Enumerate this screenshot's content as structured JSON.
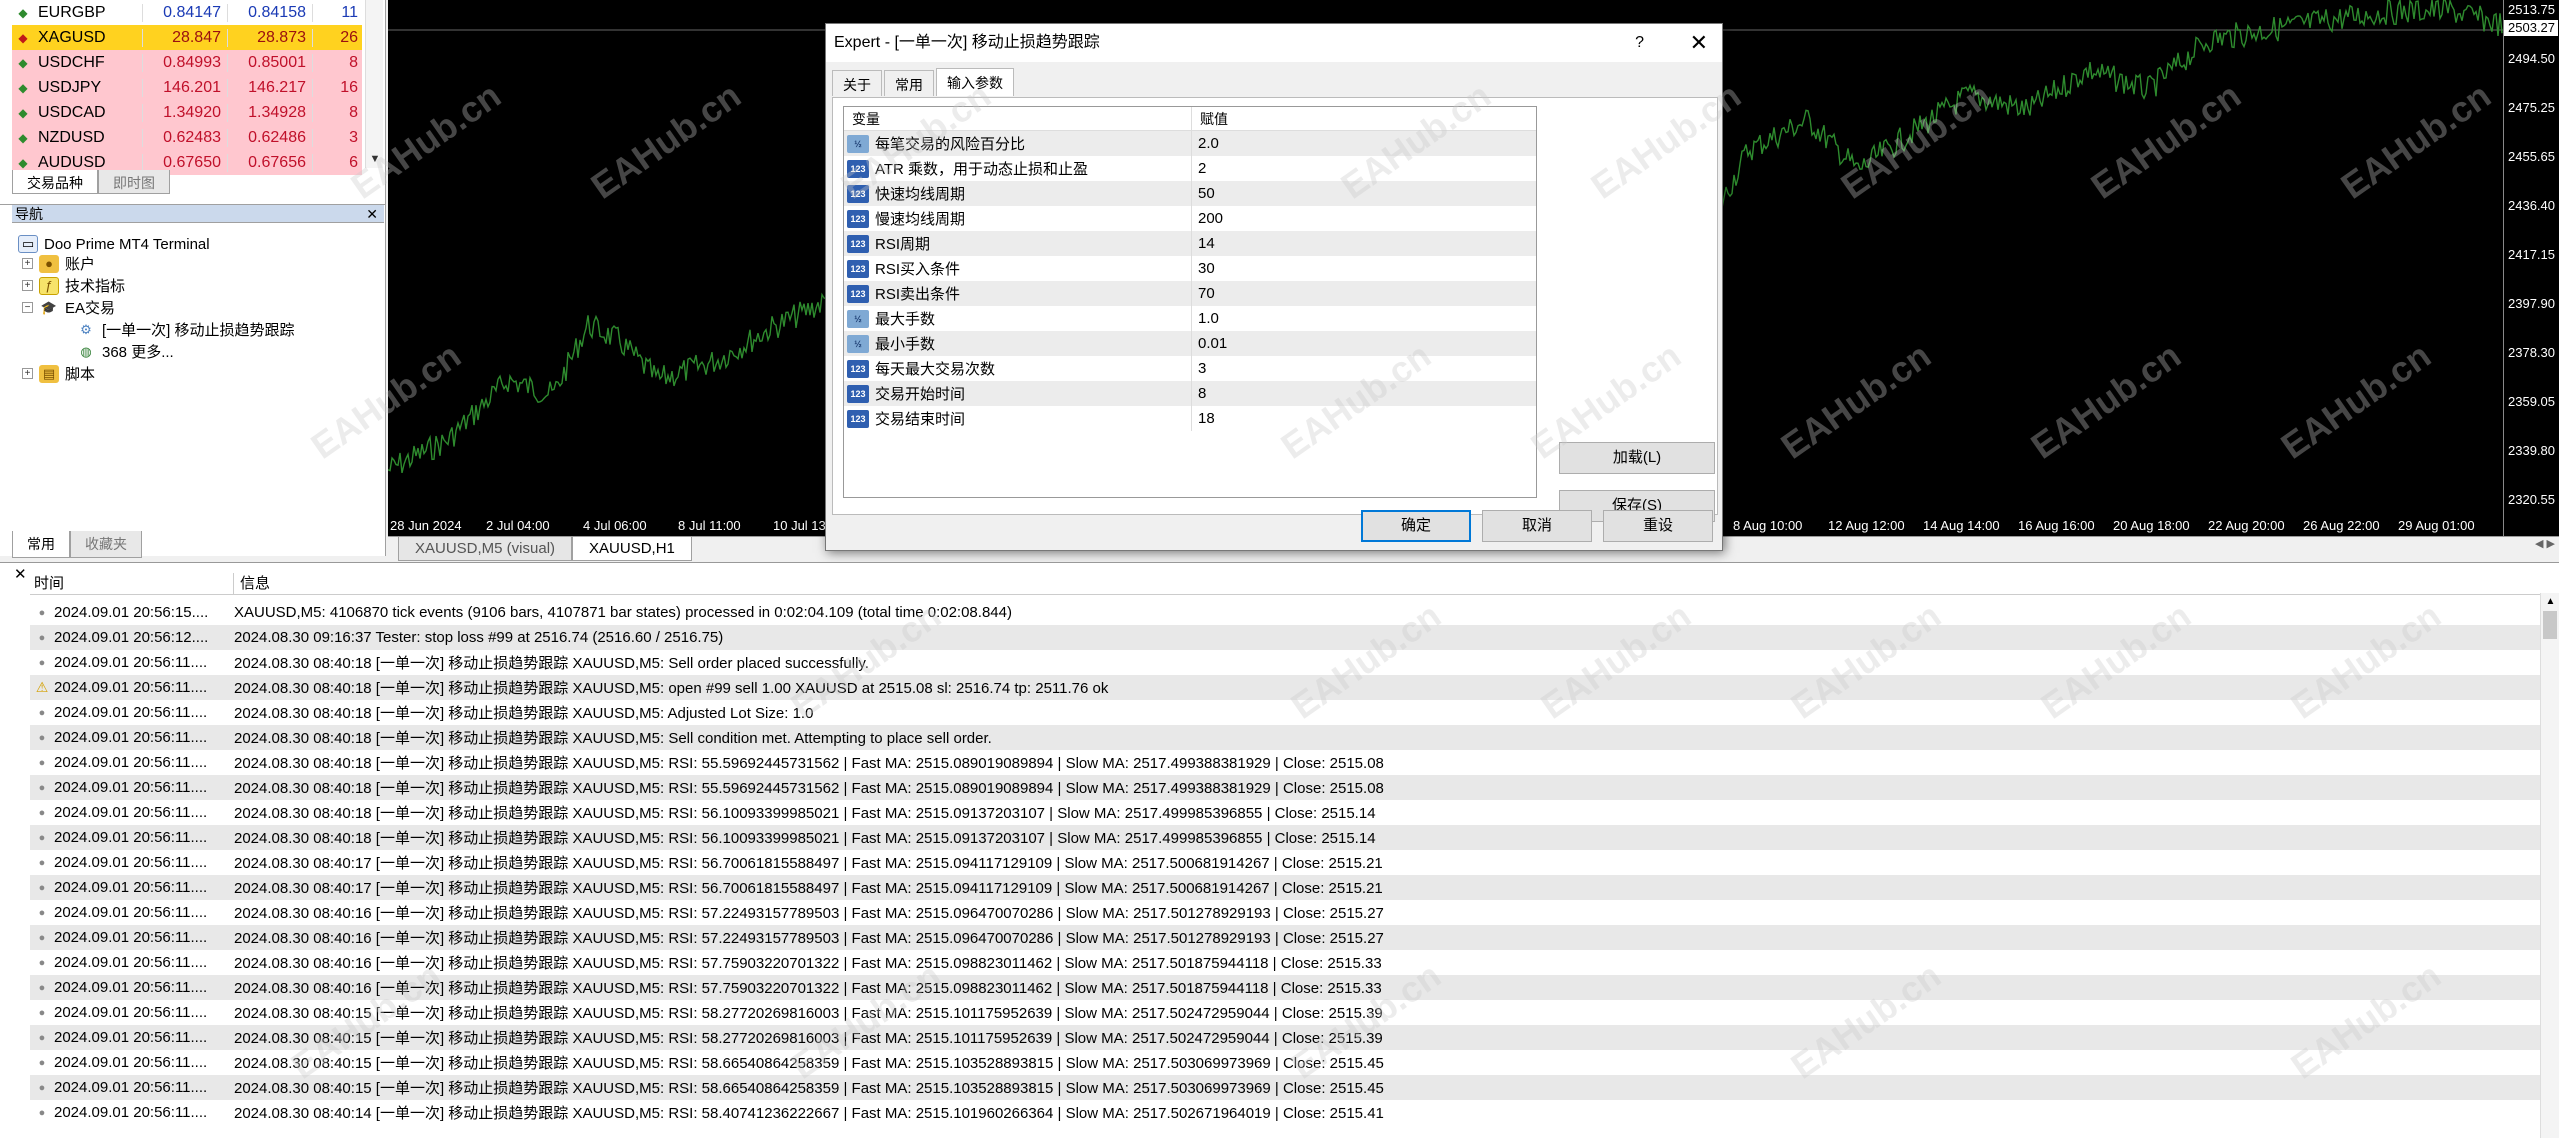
{
  "market_watch": {
    "rows": [
      {
        "symbol": "EURGBP",
        "bid": "0.84147",
        "ask": "0.84158",
        "spread": "11",
        "style": "white",
        "arrow": "◆"
      },
      {
        "symbol": "XAGUSD",
        "bid": "28.847",
        "ask": "28.873",
        "spread": "26",
        "style": "yellow",
        "arrow": "◆"
      },
      {
        "symbol": "USDCHF",
        "bid": "0.84993",
        "ask": "0.85001",
        "spread": "8",
        "style": "pink",
        "arrow": "◆"
      },
      {
        "symbol": "USDJPY",
        "bid": "146.201",
        "ask": "146.217",
        "spread": "16",
        "style": "pink",
        "arrow": "◆"
      },
      {
        "symbol": "USDCAD",
        "bid": "1.34920",
        "ask": "1.34928",
        "spread": "8",
        "style": "pink",
        "arrow": "◆"
      },
      {
        "symbol": "NZDUSD",
        "bid": "0.62483",
        "ask": "0.62486",
        "spread": "3",
        "style": "pink",
        "arrow": "◆"
      },
      {
        "symbol": "AUDUSD",
        "bid": "0.67650",
        "ask": "0.67656",
        "spread": "6",
        "style": "pink",
        "arrow": "◆"
      }
    ],
    "tabs": [
      "交易品种",
      "即时图"
    ]
  },
  "navigator": {
    "title": "导航",
    "root": "Doo Prime MT4 Terminal",
    "accounts": "账户",
    "indicators": "技术指标",
    "ea": "EA交易",
    "ea_item": "[一单一次] 移动止损趋势跟踪",
    "more": "368 更多...",
    "scripts": "脚本",
    "tabs": [
      "常用",
      "收藏夹"
    ]
  },
  "chart": {
    "line_color": "#2e8b2e",
    "prices": [
      "2513.75",
      "2494.50",
      "2475.25",
      "2455.65",
      "2436.40",
      "2417.15",
      "2397.90",
      "2378.30",
      "2359.05",
      "2339.80",
      "2320.55"
    ],
    "current_price": "2503.27",
    "times_left": [
      "28 Jun 2024",
      "2 Jul 04:00",
      "4 Jul 06:00",
      "8 Jul 11:00",
      "10 Jul 13"
    ],
    "times_right": [
      "8 Aug 10:00",
      "12 Aug 12:00",
      "14 Aug 14:00",
      "16 Aug 16:00",
      "20 Aug 18:00",
      "22 Aug 20:00",
      "26 Aug 22:00",
      "29 Aug 01:00"
    ],
    "tabs": [
      "XAUUSD,M5 (visual)",
      "XAUUSD,H1"
    ]
  },
  "dialog": {
    "title": "Expert - [一单一次] 移动止损趋势跟踪",
    "help": "?",
    "close": "✕",
    "tabs": [
      "关于",
      "常用",
      "输入参数"
    ],
    "col_var": "变量",
    "col_val": "赋值",
    "params": [
      {
        "name": "每笔交易的风险百分比",
        "value": "2.0",
        "type": "dbl"
      },
      {
        "name": "ATR 乘数，用于动态止损和止盈",
        "value": "2",
        "type": "int"
      },
      {
        "name": "快速均线周期",
        "value": "50",
        "type": "int"
      },
      {
        "name": "慢速均线周期",
        "value": "200",
        "type": "int"
      },
      {
        "name": "RSI周期",
        "value": "14",
        "type": "int"
      },
      {
        "name": "RSI买入条件",
        "value": "30",
        "type": "int"
      },
      {
        "name": "RSI卖出条件",
        "value": "70",
        "type": "int"
      },
      {
        "name": "最大手数",
        "value": "1.0",
        "type": "dbl"
      },
      {
        "name": "最小手数",
        "value": "0.01",
        "type": "dbl"
      },
      {
        "name": "每天最大交易次数",
        "value": "3",
        "type": "int"
      },
      {
        "name": "交易开始时间",
        "value": "8",
        "type": "int"
      },
      {
        "name": "交易结束时间",
        "value": "18",
        "type": "int"
      }
    ],
    "btn_load": "加载(L)",
    "btn_save": "保存(S)",
    "btn_ok": "确定",
    "btn_cancel": "取消",
    "btn_reset": "重设"
  },
  "journal": {
    "col_time": "时间",
    "col_msg": "信息",
    "rows": [
      {
        "time": "2024.09.01 20:56:15....",
        "msg": "XAUUSD,M5: 4106870 tick events (9106 bars, 4107871 bar states) processed in 0:02:04.109 (total time 0:02:08.844)",
        "warn": false
      },
      {
        "time": "2024.09.01 20:56:12....",
        "msg": "2024.08.30 09:16:37  Tester: stop loss #99 at 2516.74 (2516.60 / 2516.75)",
        "warn": false
      },
      {
        "time": "2024.09.01 20:56:11....",
        "msg": "2024.08.30 08:40:18   [一单一次] 移动止损趋势跟踪 XAUUSD,M5: Sell order placed successfully.",
        "warn": false
      },
      {
        "time": "2024.09.01 20:56:11....",
        "msg": "2024.08.30 08:40:18   [一单一次] 移动止损趋势跟踪 XAUUSD,M5: open #99 sell 1.00 XAUUSD at 2515.08 sl: 2516.74 tp: 2511.76 ok",
        "warn": true
      },
      {
        "time": "2024.09.01 20:56:11....",
        "msg": "2024.08.30 08:40:18   [一单一次] 移动止损趋势跟踪 XAUUSD,M5: Adjusted Lot Size: 1.0",
        "warn": false
      },
      {
        "time": "2024.09.01 20:56:11....",
        "msg": "2024.08.30 08:40:18   [一单一次] 移动止损趋势跟踪 XAUUSD,M5: Sell condition met. Attempting to place sell order.",
        "warn": false
      },
      {
        "time": "2024.09.01 20:56:11....",
        "msg": "2024.08.30 08:40:18   [一单一次] 移动止损趋势跟踪 XAUUSD,M5: RSI: 55.59692445731562 | Fast MA: 2515.089019089894 | Slow MA: 2517.499388381929 | Close: 2515.08",
        "warn": false
      },
      {
        "time": "2024.09.01 20:56:11....",
        "msg": "2024.08.30 08:40:18   [一单一次] 移动止损趋势跟踪 XAUUSD,M5: RSI: 55.59692445731562 | Fast MA: 2515.089019089894 | Slow MA: 2517.499388381929 | Close: 2515.08",
        "warn": false
      },
      {
        "time": "2024.09.01 20:56:11....",
        "msg": "2024.08.30 08:40:18   [一单一次] 移动止损趋势跟踪 XAUUSD,M5: RSI: 56.10093399985021 | Fast MA: 2515.09137203107 | Slow MA: 2517.499985396855 | Close: 2515.14",
        "warn": false
      },
      {
        "time": "2024.09.01 20:56:11....",
        "msg": "2024.08.30 08:40:18   [一单一次] 移动止损趋势跟踪 XAUUSD,M5: RSI: 56.10093399985021 | Fast MA: 2515.09137203107 | Slow MA: 2517.499985396855 | Close: 2515.14",
        "warn": false
      },
      {
        "time": "2024.09.01 20:56:11....",
        "msg": "2024.08.30 08:40:17   [一单一次] 移动止损趋势跟踪 XAUUSD,M5: RSI: 56.70061815588497 | Fast MA: 2515.094117129109 | Slow MA: 2517.500681914267 | Close: 2515.21",
        "warn": false
      },
      {
        "time": "2024.09.01 20:56:11....",
        "msg": "2024.08.30 08:40:17   [一单一次] 移动止损趋势跟踪 XAUUSD,M5: RSI: 56.70061815588497 | Fast MA: 2515.094117129109 | Slow MA: 2517.500681914267 | Close: 2515.21",
        "warn": false
      },
      {
        "time": "2024.09.01 20:56:11....",
        "msg": "2024.08.30 08:40:16   [一单一次] 移动止损趋势跟踪 XAUUSD,M5: RSI: 57.22493157789503 | Fast MA: 2515.096470070286 | Slow MA: 2517.501278929193 | Close: 2515.27",
        "warn": false
      },
      {
        "time": "2024.09.01 20:56:11....",
        "msg": "2024.08.30 08:40:16   [一单一次] 移动止损趋势跟踪 XAUUSD,M5: RSI: 57.22493157789503 | Fast MA: 2515.096470070286 | Slow MA: 2517.501278929193 | Close: 2515.27",
        "warn": false
      },
      {
        "time": "2024.09.01 20:56:11....",
        "msg": "2024.08.30 08:40:16   [一单一次] 移动止损趋势跟踪 XAUUSD,M5: RSI: 57.75903220701322 | Fast MA: 2515.098823011462 | Slow MA: 2517.501875944118 | Close: 2515.33",
        "warn": false
      },
      {
        "time": "2024.09.01 20:56:11....",
        "msg": "2024.08.30 08:40:16   [一单一次] 移动止损趋势跟踪 XAUUSD,M5: RSI: 57.75903220701322 | Fast MA: 2515.098823011462 | Slow MA: 2517.501875944118 | Close: 2515.33",
        "warn": false
      },
      {
        "time": "2024.09.01 20:56:11....",
        "msg": "2024.08.30 08:40:15   [一单一次] 移动止损趋势跟踪 XAUUSD,M5: RSI: 58.27720269816003 | Fast MA: 2515.101175952639 | Slow MA: 2517.502472959044 | Close: 2515.39",
        "warn": false
      },
      {
        "time": "2024.09.01 20:56:11....",
        "msg": "2024.08.30 08:40:15   [一单一次] 移动止损趋势跟踪 XAUUSD,M5: RSI: 58.27720269816003 | Fast MA: 2515.101175952639 | Slow MA: 2517.502472959044 | Close: 2515.39",
        "warn": false
      },
      {
        "time": "2024.09.01 20:56:11....",
        "msg": "2024.08.30 08:40:15   [一单一次] 移动止损趋势跟踪 XAUUSD,M5: RSI: 58.66540864258359 | Fast MA: 2515.103528893815 | Slow MA: 2517.503069973969 | Close: 2515.45",
        "warn": false
      },
      {
        "time": "2024.09.01 20:56:11....",
        "msg": "2024.08.30 08:40:15   [一单一次] 移动止损趋势跟踪 XAUUSD,M5: RSI: 58.66540864258359 | Fast MA: 2515.103528893815 | Slow MA: 2517.503069973969 | Close: 2515.45",
        "warn": false
      },
      {
        "time": "2024.09.01 20:56:11....",
        "msg": "2024.08.30 08:40:14   [一单一次] 移动止损趋势跟踪 XAUUSD,M5: RSI: 58.40741236222667 | Fast MA: 2515.101960266364 | Slow MA: 2517.502671964019 | Close: 2515.41",
        "warn": false
      }
    ]
  },
  "watermark": "EAHub.cn"
}
